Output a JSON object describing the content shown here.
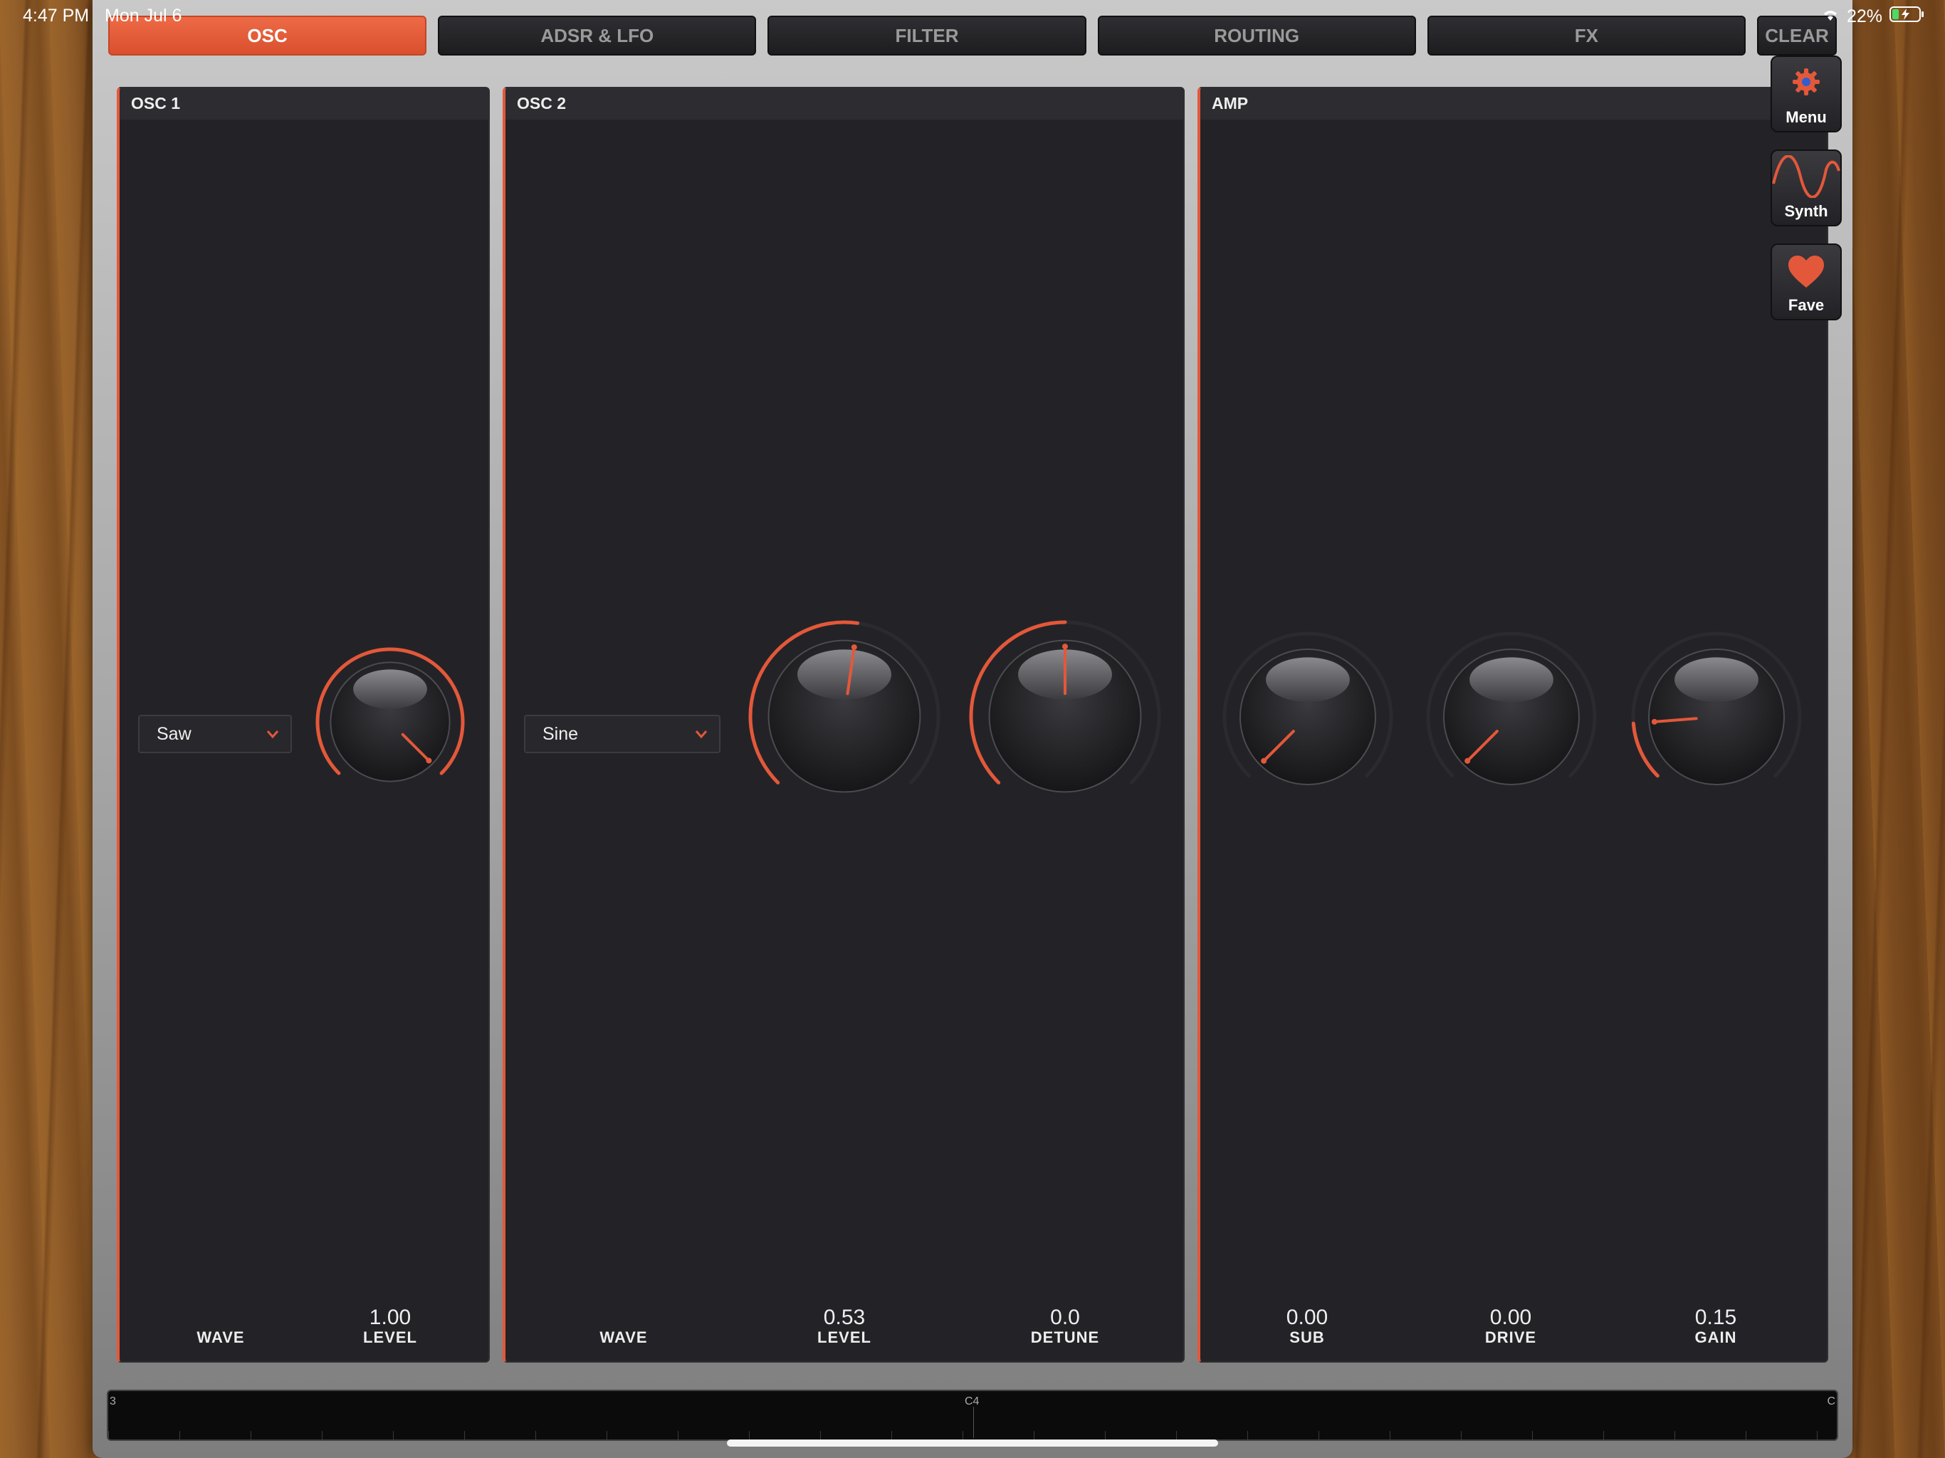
{
  "status_bar": {
    "time": "4:47 PM",
    "date": "Mon Jul 6",
    "battery": "22%"
  },
  "tabs": [
    {
      "label": "OSC",
      "active": true
    },
    {
      "label": "ADSR & LFO",
      "active": false
    },
    {
      "label": "FILTER",
      "active": false
    },
    {
      "label": "ROUTING",
      "active": false
    },
    {
      "label": "FX",
      "active": false
    },
    {
      "label": "CLEAR",
      "active": false
    }
  ],
  "panels": {
    "osc1": {
      "title": "OSC 1",
      "wave": {
        "label": "WAVE",
        "selected": "Saw"
      },
      "level": {
        "label": "LEVEL",
        "value": "1.00",
        "fraction": 1.0
      }
    },
    "osc2": {
      "title": "OSC 2",
      "wave": {
        "label": "WAVE",
        "selected": "Sine"
      },
      "level": {
        "label": "LEVEL",
        "value": "0.53",
        "fraction": 0.53
      },
      "detune": {
        "label": "DETUNE",
        "value": "0.0",
        "fraction": 0.5
      }
    },
    "amp": {
      "title": "AMP",
      "sub": {
        "label": "SUB",
        "value": "0.00",
        "fraction": 0.0
      },
      "drive": {
        "label": "DRIVE",
        "value": "0.00",
        "fraction": 0.0
      },
      "gain": {
        "label": "GAIN",
        "value": "0.15",
        "fraction": 0.15
      }
    }
  },
  "sidebar": {
    "menu": {
      "label": "Menu",
      "icon": "gear-icon"
    },
    "synth": {
      "label": "Synth",
      "icon": "sine-wave-icon"
    },
    "fave": {
      "label": "Fave",
      "icon": "heart-icon"
    }
  },
  "keyboard": {
    "labels": [
      "3",
      "C4",
      "C"
    ]
  },
  "colors": {
    "accent": "#e3583a",
    "panel": "#232327",
    "track": "#2b2b2f"
  }
}
